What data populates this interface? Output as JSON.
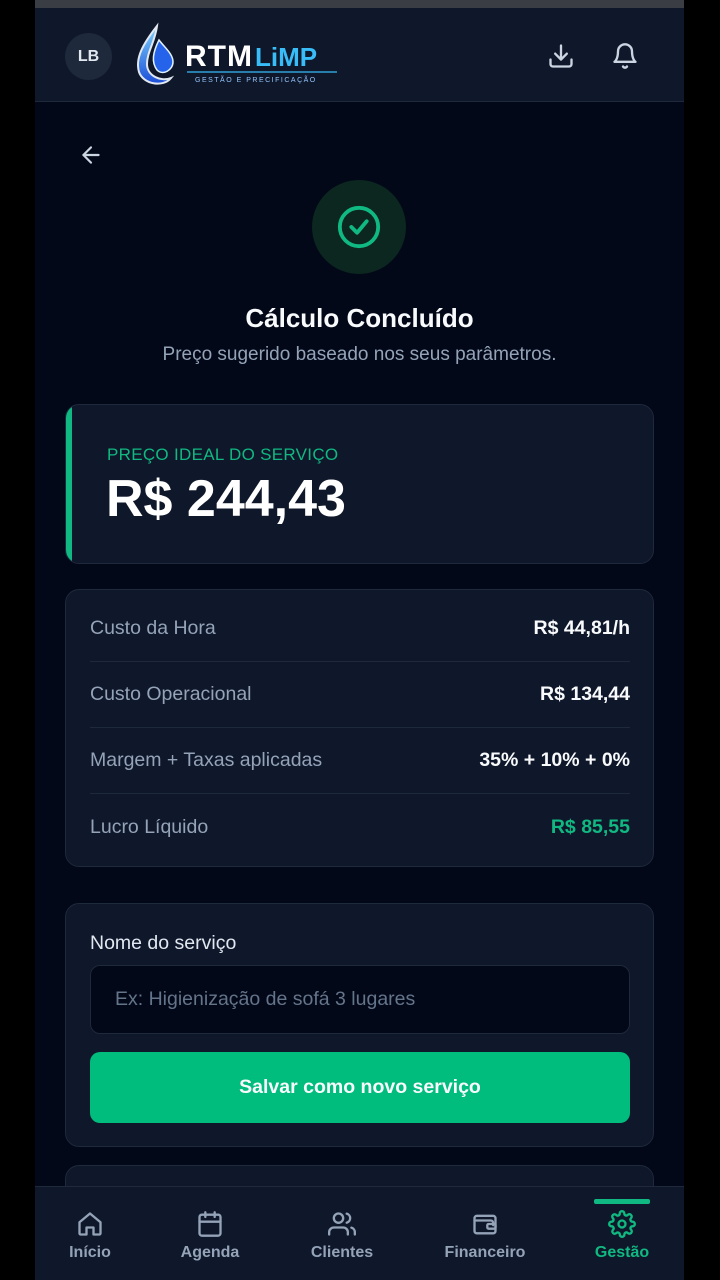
{
  "header": {
    "avatar_initials": "LB",
    "logo": {
      "name": "RTMLimp",
      "tagline": "GESTÃO E PRECIFICAÇÃO"
    },
    "icons": [
      "download-icon",
      "bell-icon"
    ]
  },
  "result": {
    "title": "Cálculo Concluído",
    "subtitle": "Preço sugerido baseado nos seus parâmetros."
  },
  "price": {
    "label": "PREÇO IDEAL DO SERVIÇO",
    "value": "R$ 244,43"
  },
  "details": [
    {
      "label": "Custo da Hora",
      "value": "R$ 44,81/h"
    },
    {
      "label": "Custo Operacional",
      "value": "R$ 134,44"
    },
    {
      "label": "Margem + Taxas aplicadas",
      "value": "35% + 10% + 0%"
    },
    {
      "label": "Lucro Líquido",
      "value": "R$ 85,55"
    }
  ],
  "form": {
    "label": "Nome do serviço",
    "placeholder": "Ex: Higienização de sofá 3 lugares",
    "value": "",
    "save_label": "Salvar como novo serviço"
  },
  "nav": {
    "items": [
      {
        "label": "Início",
        "icon": "home-icon"
      },
      {
        "label": "Agenda",
        "icon": "calendar-icon"
      },
      {
        "label": "Clientes",
        "icon": "users-icon"
      },
      {
        "label": "Financeiro",
        "icon": "wallet-icon"
      },
      {
        "label": "Gestão",
        "icon": "gear-icon"
      }
    ],
    "active": "Gestão"
  },
  "colors": {
    "accent": "#10b981",
    "button": "#00bd7e",
    "background": "#020817",
    "card": "#0f172a",
    "border": "#1e293b",
    "muted_text": "#94a3b8"
  }
}
